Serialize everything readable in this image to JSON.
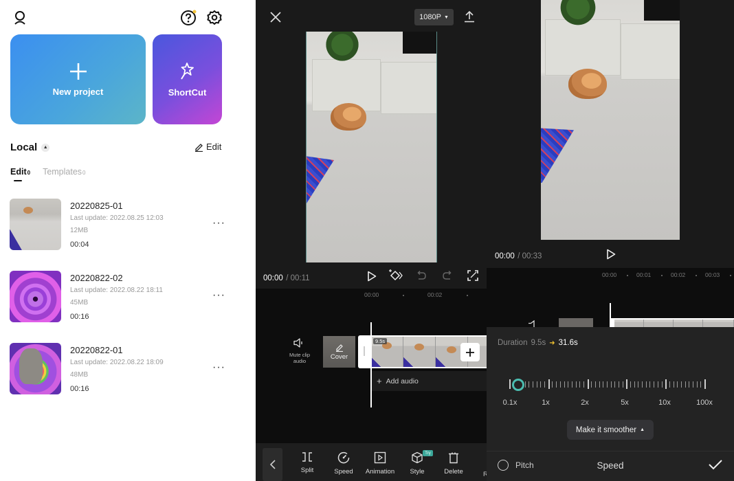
{
  "home": {
    "new_project_label": "New project",
    "shortcut_label": "ShortCut",
    "local_label": "Local",
    "edit_label": "Edit",
    "tabs": [
      {
        "label": "Edit",
        "count": "0",
        "active": true
      },
      {
        "label": "Templates",
        "count": "0",
        "active": false
      }
    ],
    "projects": [
      {
        "name": "20220825-01",
        "updated": "Last update: 2022.08.25 12:03",
        "size": "12MB",
        "duration": "00:04",
        "thumb": "dog"
      },
      {
        "name": "20220822-02",
        "updated": "Last update: 2022.08.22 18:11",
        "size": "45MB",
        "duration": "00:16",
        "thumb": "heart"
      },
      {
        "name": "20220822-01",
        "updated": "Last update: 2022.08.22 18:09",
        "size": "48MB",
        "duration": "00:16",
        "thumb": "heart-dog"
      }
    ],
    "more_label": "···"
  },
  "editor": {
    "resolution": "1080P",
    "time_current": "00:00",
    "time_total": "/ 00:11",
    "ruler": [
      "00:00",
      "00:02"
    ],
    "mute_label_line1": "Mute clip",
    "mute_label_line2": "audio",
    "cover_label": "Cover",
    "clip_duration": "9.5s",
    "add_audio_label": "Add audio",
    "tools": [
      {
        "label": "Split",
        "icon": "split-icon"
      },
      {
        "label": "Speed",
        "icon": "speed-icon"
      },
      {
        "label": "Animation",
        "icon": "animation-icon"
      },
      {
        "label": "Style",
        "icon": "style-icon"
      },
      {
        "label": "Delete",
        "icon": "delete-icon"
      }
    ],
    "try_badge": "Try",
    "partial_tool": "R"
  },
  "speed": {
    "time_current": "00:00",
    "time_total": "/ 00:33",
    "ruler": [
      "00:00",
      "00:01",
      "00:02",
      "00:03"
    ],
    "duration_label": "Duration",
    "duration_old": "9.5s",
    "duration_new": "31.6s",
    "scale_labels": [
      "0.1x",
      "1x",
      "2x",
      "5x",
      "10x",
      "100x"
    ],
    "slider_value": "0.3x",
    "smooth_label": "Make it smoother",
    "pitch_label": "Pitch",
    "title": "Speed",
    "accent": "#4bbcb0",
    "arrow_color": "#f2c230"
  }
}
